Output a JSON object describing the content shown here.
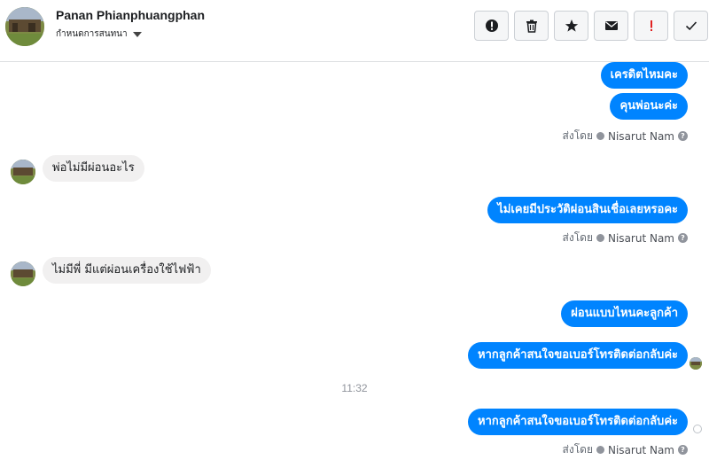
{
  "header": {
    "contact_name": "Panan Phianphuangphan",
    "subtitle": "กำหนดการสนทนา"
  },
  "toolbar": {
    "buttons": [
      {
        "name": "report-icon"
      },
      {
        "name": "trash-icon"
      },
      {
        "name": "star-icon"
      },
      {
        "name": "envelope-icon"
      },
      {
        "name": "important-icon"
      },
      {
        "name": "check-icon"
      }
    ]
  },
  "conversation": {
    "messages": [
      {
        "text": "เครดิตไหมคะ",
        "direction": "outgoing"
      },
      {
        "text": "คุนพ่อนะค่ะ",
        "direction": "outgoing"
      },
      {
        "text": "พ่อไม่มีผ่อนอะไร",
        "direction": "incoming"
      },
      {
        "text": "ไม่เคยมีประวัติผ่อนสินเชื่อเลยหรอคะ",
        "direction": "outgoing"
      },
      {
        "text": "ไม่มีพี่ มีแต่ผ่อนเครื่องใช้ไฟฟ้า",
        "direction": "incoming"
      },
      {
        "text": "ผ่อนแบบไหนคะลูกค้า",
        "direction": "outgoing"
      },
      {
        "text": "หากลูกค้าสนใจขอเบอร์โทรติดต่อกลับค่ะ",
        "direction": "outgoing"
      },
      {
        "text": "หากลูกค้าสนใจขอเบอร์โทรติดต่อกลับค่ะ",
        "direction": "outgoing"
      }
    ],
    "sent_by_label": "ส่งโดย",
    "sent_by_name": "Nisarut Nam",
    "timestamp": "11:32"
  },
  "colors": {
    "outgoing_bubble": "#0084ff",
    "incoming_bubble": "#f1f0f0",
    "important_red": "#e02020"
  }
}
